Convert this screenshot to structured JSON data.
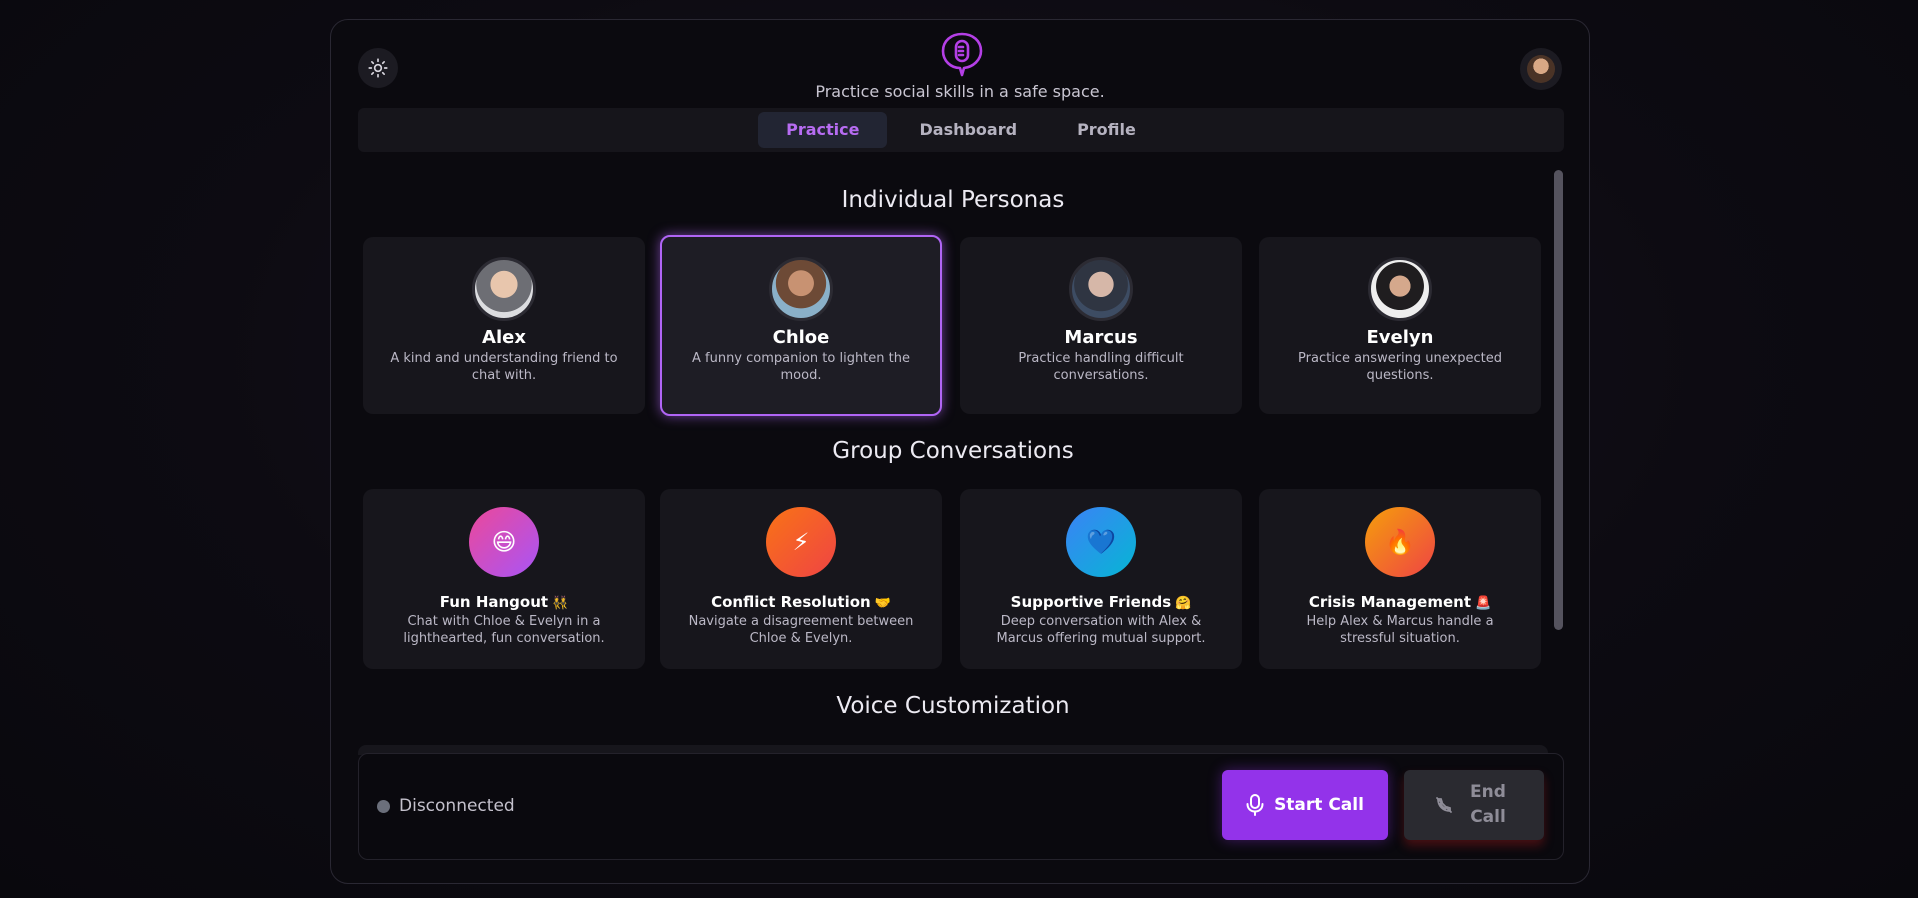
{
  "header": {
    "tagline": "Practice social skills in a safe space.",
    "theme_icon": "sun-icon",
    "logo_icon": "mic-bubble-logo-icon",
    "accent": "#9333ea"
  },
  "tabs": [
    {
      "label": "Practice",
      "active": true
    },
    {
      "label": "Dashboard",
      "active": false
    },
    {
      "label": "Profile",
      "active": false
    }
  ],
  "individual": {
    "title": "Individual Personas",
    "personas": [
      {
        "name": "Alex",
        "desc": "A kind and understanding friend to chat with.",
        "selected": false
      },
      {
        "name": "Chloe",
        "desc": "A funny companion to lighten the mood.",
        "selected": true
      },
      {
        "name": "Marcus",
        "desc": "Practice handling difficult conversations.",
        "selected": false
      },
      {
        "name": "Evelyn",
        "desc": "Practice answering unexpected questions.",
        "selected": false
      }
    ]
  },
  "groups": {
    "title": "Group Conversations",
    "items": [
      {
        "name": "Fun Hangout",
        "emoji": "👯",
        "icon": "😄",
        "desc": "Chat with Chloe & Evelyn in a lighthearted, fun conversation."
      },
      {
        "name": "Conflict Resolution",
        "emoji": "🤝",
        "icon": "⚡",
        "desc": "Navigate a disagreement between Chloe & Evelyn."
      },
      {
        "name": "Supportive Friends",
        "emoji": "🤗",
        "icon": "💙",
        "desc": "Deep conversation with Alex & Marcus offering mutual support."
      },
      {
        "name": "Crisis Management",
        "emoji": "🚨",
        "icon": "🔥",
        "desc": "Help Alex & Marcus handle a stressful situation."
      }
    ]
  },
  "voice": {
    "title": "Voice Customization"
  },
  "footer": {
    "status": "Disconnected",
    "start_label": "Start Call",
    "end_label": "End Call"
  }
}
